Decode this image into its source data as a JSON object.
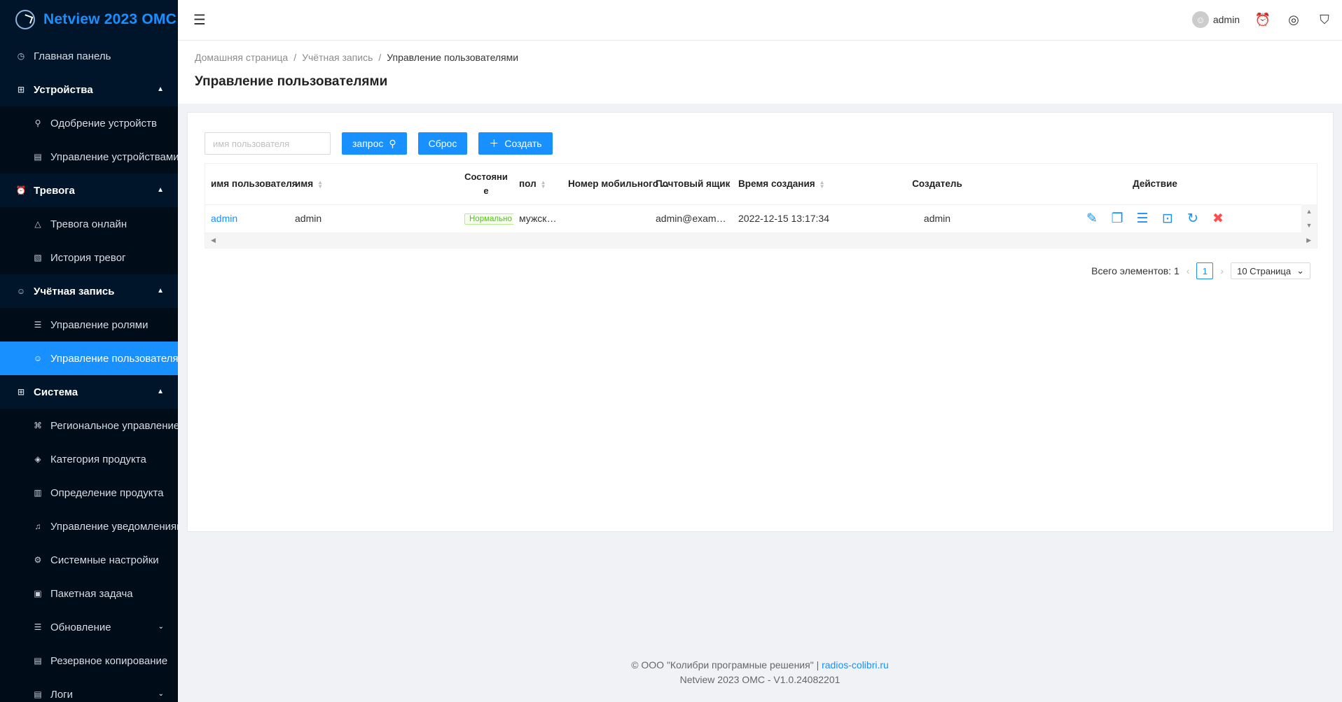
{
  "app": {
    "title": "Netview 2023 OMC"
  },
  "sidebar": {
    "items": [
      {
        "label": "Главная панель",
        "icon": "dashboard-icon",
        "glyph": "◷",
        "kind": "parent-plain"
      },
      {
        "label": "Устройства",
        "icon": "devices-icon",
        "glyph": "⊞",
        "kind": "parent",
        "arrow": "▲"
      },
      {
        "label": "Одобрение устройств",
        "icon": "link-icon",
        "glyph": "⚲",
        "kind": "sub"
      },
      {
        "label": "Управление устройствами",
        "icon": "list-doc-icon",
        "glyph": "▤",
        "kind": "sub"
      },
      {
        "label": "Тревога",
        "icon": "alarm-icon",
        "glyph": "⏰",
        "kind": "parent",
        "arrow": "▲"
      },
      {
        "label": "Тревога онлайн",
        "icon": "warning-icon",
        "glyph": "△",
        "kind": "sub"
      },
      {
        "label": "История тревог",
        "icon": "history-icon",
        "glyph": "▧",
        "kind": "sub"
      },
      {
        "label": "Учётная запись",
        "icon": "user-icon",
        "glyph": "☺",
        "kind": "parent",
        "arrow": "▲"
      },
      {
        "label": "Управление ролями",
        "icon": "menu-lines-icon",
        "glyph": "☰",
        "kind": "sub"
      },
      {
        "label": "Управление пользователями",
        "icon": "users-icon",
        "glyph": "☺",
        "kind": "sub",
        "active": true
      },
      {
        "label": "Система",
        "icon": "grid-icon",
        "glyph": "⊞",
        "kind": "parent",
        "arrow": "▲"
      },
      {
        "label": "Региональное управление",
        "icon": "cluster-icon",
        "glyph": "⌘",
        "kind": "sub"
      },
      {
        "label": "Категория продукта",
        "icon": "tag-icon",
        "glyph": "◈",
        "kind": "sub"
      },
      {
        "label": "Определение продукта",
        "icon": "chart-box-icon",
        "glyph": "▥",
        "kind": "sub"
      },
      {
        "label": "Управление уведомлениями",
        "icon": "bell-icon",
        "glyph": "♫",
        "kind": "sub"
      },
      {
        "label": "Системные настройки",
        "icon": "gear-icon",
        "glyph": "⚙",
        "kind": "sub"
      },
      {
        "label": "Пакетная задача",
        "icon": "task-icon",
        "glyph": "▣",
        "kind": "sub"
      },
      {
        "label": "Обновление",
        "icon": "update-list-icon",
        "glyph": "☰",
        "kind": "sub",
        "arrow": "⌄"
      },
      {
        "label": "Резервное копирование",
        "icon": "backup-icon",
        "glyph": "▤",
        "kind": "sub"
      },
      {
        "label": "Логи",
        "icon": "logs-icon",
        "glyph": "▤",
        "kind": "sub",
        "arrow": "⌄"
      }
    ]
  },
  "header": {
    "user": "admin"
  },
  "breadcrumb": {
    "home": "Домашняя страница",
    "section": "Учётная запись",
    "current": "Управление пользователями"
  },
  "page": {
    "title": "Управление пользователями"
  },
  "toolbar": {
    "search_placeholder": "имя пользователя",
    "query_label": "запрос",
    "reset_label": "Сброс",
    "create_label": "Создать"
  },
  "table": {
    "columns": {
      "username": "имя пользователя",
      "name": "имя",
      "status": "Состояни е",
      "gender": "пол",
      "phone": "Номер мобильного ...",
      "email": "Почтовый ящик",
      "created": "Время создания",
      "creator": "Создатель",
      "action": "Действие"
    },
    "rows": [
      {
        "username": "admin",
        "name": "admin",
        "status": "Нормально",
        "gender": "мужской",
        "phone": "",
        "email": "admin@exampl...",
        "created": "2022-12-15 13:17:34",
        "creator": "admin"
      }
    ]
  },
  "pagination": {
    "total_label": "Всего элементов: 1",
    "current_page": "1",
    "page_size": "10 Страница"
  },
  "footer": {
    "line1_prefix": "© ООО \"Колибри програмные решения\" |",
    "link": "radios-colibri.ru",
    "line2": "Netview 2023 OMC - V1.0.24082201"
  },
  "colors": {
    "primary": "#1890ff",
    "sidebar_bg": "#001529",
    "danger": "#ff4d4f",
    "success": "#52c41a"
  }
}
